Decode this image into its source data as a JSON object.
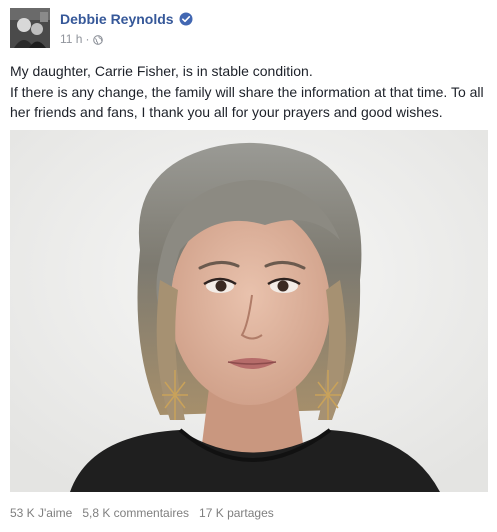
{
  "post": {
    "author": "Debbie Reynolds",
    "time": "11 h",
    "separator": "·",
    "verified_icon": "verified-badge-icon",
    "privacy_icon": "globe-icon",
    "text_lines": [
      "My daughter, Carrie Fisher, is in stable condition.",
      "If there is any change, the family will share the information at that time. To all her friends and fans, I thank you all for your prayers and good wishes."
    ],
    "photo_icon": "portrait-photo",
    "stats": {
      "likes": "53 K J'aime",
      "comments": "5,8 K commentaires",
      "shares": "17 K partages"
    }
  },
  "colors": {
    "author_link": "#365899",
    "verified": "#4267b2",
    "meta": "#90949c",
    "body_text": "#1d2129",
    "footer": "#7f7f7f"
  }
}
